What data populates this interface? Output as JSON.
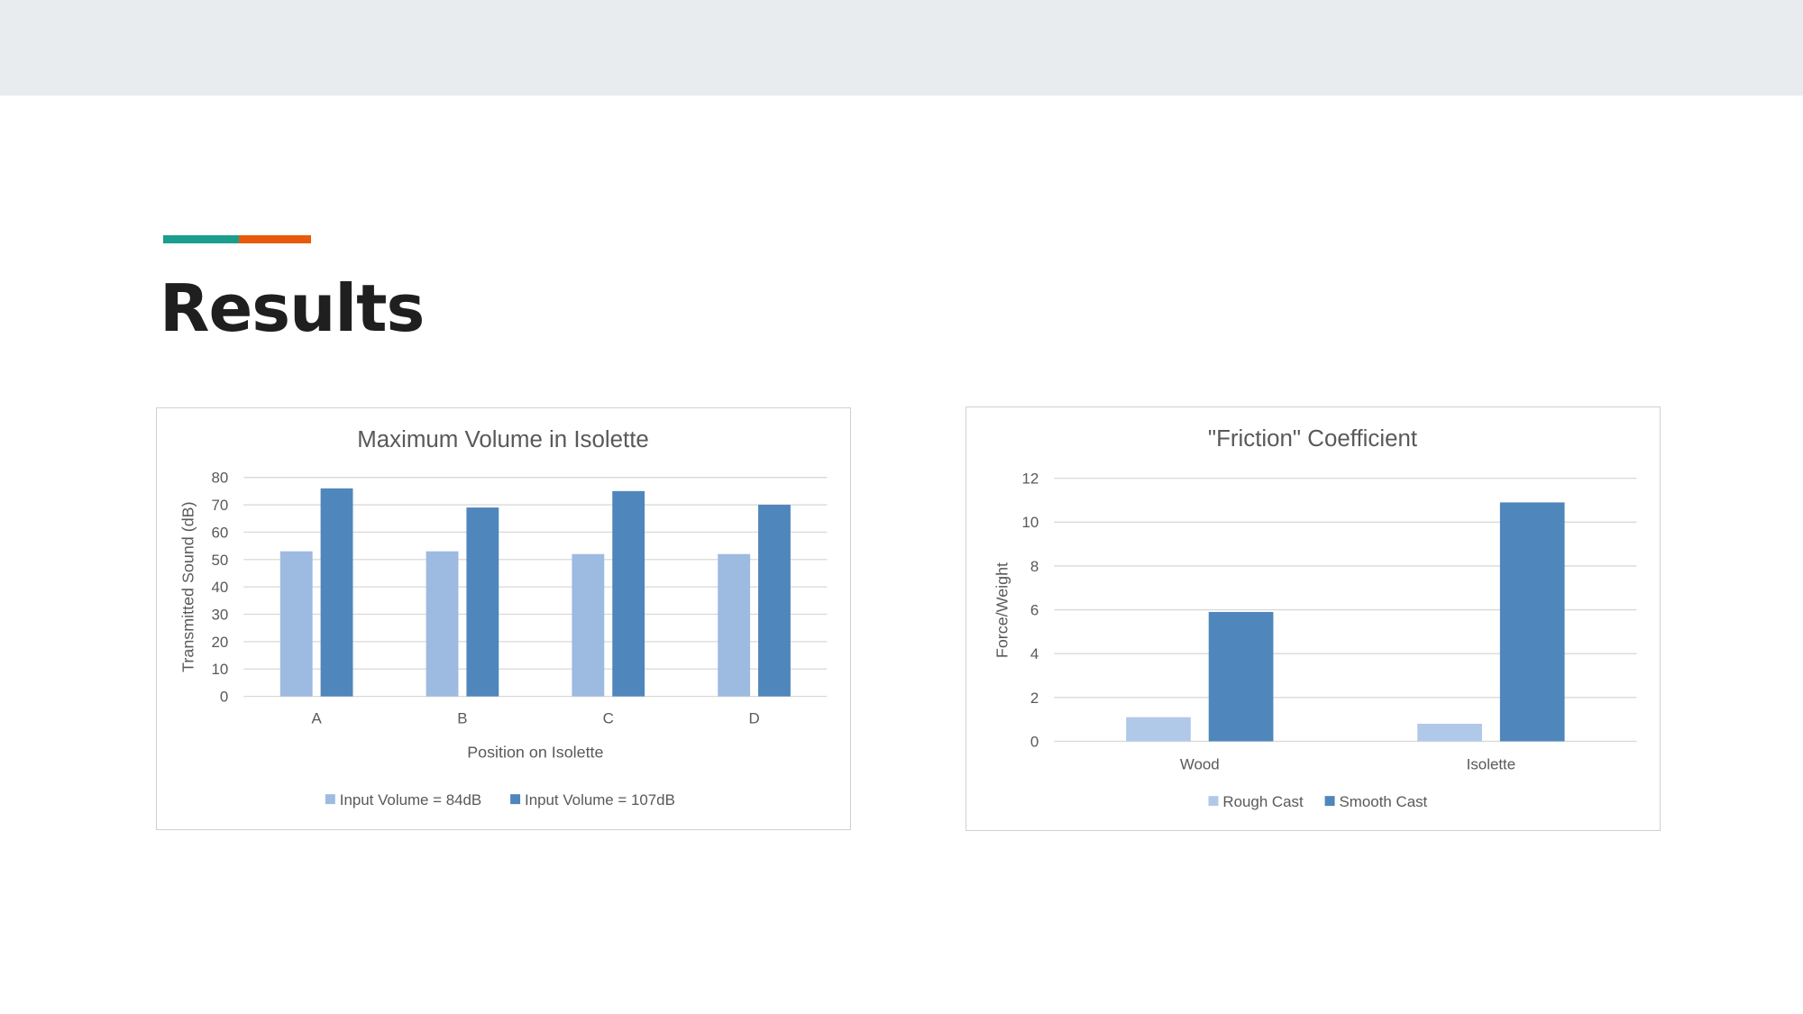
{
  "slide": {
    "title": "Results",
    "accent_colors": [
      "#1a9e8f",
      "#e8590c"
    ],
    "background_band_color": "#e8ecee"
  },
  "chart_data": [
    {
      "type": "bar",
      "title": "Maximum Volume in Isolette",
      "xlabel": "Position on Isolette",
      "ylabel": "Transmitted Sound (dB)",
      "categories": [
        "A",
        "B",
        "C",
        "D"
      ],
      "ylim": [
        0,
        80
      ],
      "yticks": [
        "0",
        "10",
        "20",
        "30",
        "40",
        "50",
        "60",
        "70",
        "80"
      ],
      "grid": true,
      "legend_position": "bottom",
      "series": [
        {
          "name": "Input Volume = 84dB",
          "values": [
            53,
            53,
            52,
            52
          ],
          "color": "#9dbbe1"
        },
        {
          "name": "Input Volume = 107dB",
          "values": [
            76,
            69,
            75,
            70
          ],
          "color": "#4f86bb"
        }
      ]
    },
    {
      "type": "bar",
      "title": "\"Friction\" Coefficient",
      "xlabel": "",
      "ylabel": "Force/Weight",
      "categories": [
        "Wood",
        "Isolette"
      ],
      "ylim": [
        0,
        12
      ],
      "yticks": [
        "0",
        "2",
        "4",
        "6",
        "8",
        "10",
        "12"
      ],
      "grid": true,
      "legend_position": "bottom",
      "series": [
        {
          "name": "Rough Cast",
          "values": [
            1.1,
            0.8
          ],
          "color": "#b1c9e8"
        },
        {
          "name": "Smooth Cast",
          "values": [
            5.9,
            10.9
          ],
          "color": "#4f86bb"
        }
      ]
    }
  ]
}
